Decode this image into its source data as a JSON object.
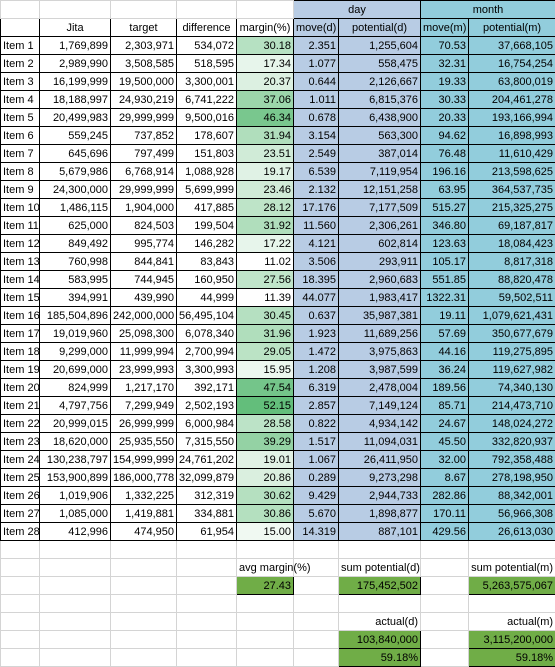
{
  "colors": {
    "day_header": "#b8cce4",
    "month_header": "#92cddc",
    "day_cells": "#b8cce4",
    "month_cells": "#92cddc",
    "summary_green": "#70ad47",
    "margin_scale_low": "#ffffff",
    "margin_scale_high": "#63be7b"
  },
  "groups": {
    "day": "day",
    "month": "month"
  },
  "headers": [
    "",
    "Jita",
    "target",
    "difference",
    "margin(%)",
    "move(d)",
    "potential(d)",
    "move(m)",
    "potential(m)"
  ],
  "rows": [
    [
      "Item 1",
      "1,769,899",
      "2,303,971",
      "534,072",
      "30.18",
      "2.351",
      "1,255,604",
      "70.53",
      "37,668,105"
    ],
    [
      "Item 2",
      "2,989,990",
      "3,508,585",
      "518,595",
      "17.34",
      "1.077",
      "558,475",
      "32.31",
      "16,754,254"
    ],
    [
      "Item 3",
      "16,199,999",
      "19,500,000",
      "3,300,001",
      "20.37",
      "0.644",
      "2,126,667",
      "19.33",
      "63,800,019"
    ],
    [
      "Item 4",
      "18,188,997",
      "24,930,219",
      "6,741,222",
      "37.06",
      "1.011",
      "6,815,376",
      "30.33",
      "204,461,278"
    ],
    [
      "Item 5",
      "20,499,983",
      "29,999,999",
      "9,500,016",
      "46.34",
      "0.678",
      "6,438,900",
      "20.33",
      "193,166,994"
    ],
    [
      "Item 6",
      "559,245",
      "737,852",
      "178,607",
      "31.94",
      "3.154",
      "563,300",
      "94.62",
      "16,898,993"
    ],
    [
      "Item 7",
      "645,696",
      "797,499",
      "151,803",
      "23.51",
      "2.549",
      "387,014",
      "76.48",
      "11,610,429"
    ],
    [
      "Item 8",
      "5,679,986",
      "6,768,914",
      "1,088,928",
      "19.17",
      "6.539",
      "7,119,954",
      "196.16",
      "213,598,625"
    ],
    [
      "Item 9",
      "24,300,000",
      "29,999,999",
      "5,699,999",
      "23.46",
      "2.132",
      "12,151,258",
      "63.95",
      "364,537,735"
    ],
    [
      "Item 10",
      "1,486,115",
      "1,904,000",
      "417,885",
      "28.12",
      "17.176",
      "7,177,509",
      "515.27",
      "215,325,275"
    ],
    [
      "Item 11",
      "625,000",
      "824,503",
      "199,504",
      "31.92",
      "11.560",
      "2,306,261",
      "346.80",
      "69,187,817"
    ],
    [
      "Item 12",
      "849,492",
      "995,774",
      "146,282",
      "17.22",
      "4.121",
      "602,814",
      "123.63",
      "18,084,423"
    ],
    [
      "Item 13",
      "760,998",
      "844,841",
      "83,843",
      "11.02",
      "3.506",
      "293,911",
      "105.17",
      "8,817,318"
    ],
    [
      "Item 14",
      "583,995",
      "744,945",
      "160,950",
      "27.56",
      "18.395",
      "2,960,683",
      "551.85",
      "88,820,478"
    ],
    [
      "Item 15",
      "394,991",
      "439,990",
      "44,999",
      "11.39",
      "44.077",
      "1,983,417",
      "1322.31",
      "59,502,511"
    ],
    [
      "Item 16",
      "185,504,896",
      "242,000,000",
      "56,495,104",
      "30.45",
      "0.637",
      "35,987,381",
      "19.11",
      "1,079,621,431"
    ],
    [
      "Item 17",
      "19,019,960",
      "25,098,300",
      "6,078,340",
      "31.96",
      "1.923",
      "11,689,256",
      "57.69",
      "350,677,679"
    ],
    [
      "Item 18",
      "9,299,000",
      "11,999,994",
      "2,700,994",
      "29.05",
      "1.472",
      "3,975,863",
      "44.16",
      "119,275,895"
    ],
    [
      "Item 19",
      "20,699,000",
      "23,999,993",
      "3,300,993",
      "15.95",
      "1.208",
      "3,987,599",
      "36.24",
      "119,627,982"
    ],
    [
      "Item 20",
      "824,999",
      "1,217,170",
      "392,171",
      "47.54",
      "6.319",
      "2,478,004",
      "189.56",
      "74,340,130"
    ],
    [
      "Item 21",
      "4,797,756",
      "7,299,949",
      "2,502,193",
      "52.15",
      "2.857",
      "7,149,124",
      "85.71",
      "214,473,710"
    ],
    [
      "Item 22",
      "20,999,015",
      "26,999,999",
      "6,000,984",
      "28.58",
      "0.822",
      "4,934,142",
      "24.67",
      "148,024,272"
    ],
    [
      "Item 23",
      "18,620,000",
      "25,935,550",
      "7,315,550",
      "39.29",
      "1.517",
      "11,094,031",
      "45.50",
      "332,820,937"
    ],
    [
      "Item 24",
      "130,238,797",
      "154,999,999",
      "24,761,202",
      "19.01",
      "1.067",
      "26,411,950",
      "32.00",
      "792,358,488"
    ],
    [
      "Item 25",
      "153,900,899",
      "186,000,778",
      "32,099,879",
      "20.86",
      "0.289",
      "9,273,298",
      "8.67",
      "278,198,950"
    ],
    [
      "Item 26",
      "1,019,906",
      "1,332,225",
      "312,319",
      "30.62",
      "9.429",
      "2,944,733",
      "282.86",
      "88,342,001"
    ],
    [
      "Item 27",
      "1,085,000",
      "1,419,881",
      "334,881",
      "30.86",
      "5.670",
      "1,898,877",
      "170.11",
      "56,966,308"
    ],
    [
      "Item 28",
      "412,996",
      "474,950",
      "61,954",
      "15.00",
      "14.319",
      "887,101",
      "429.56",
      "26,613,030"
    ]
  ],
  "margin_values": [
    30.18,
    17.34,
    20.37,
    37.06,
    46.34,
    31.94,
    23.51,
    19.17,
    23.46,
    28.12,
    31.92,
    17.22,
    11.02,
    27.56,
    11.39,
    30.45,
    31.96,
    29.05,
    15.95,
    47.54,
    52.15,
    28.58,
    39.29,
    19.01,
    20.86,
    30.62,
    30.86,
    15.0
  ],
  "summary": {
    "avg_margin_label": "avg margin(%)",
    "avg_margin_value": "27.43",
    "sum_potential_d_label": "sum potential(d)",
    "sum_potential_d_value": "175,452,502",
    "sum_potential_m_label": "sum potential(m)",
    "sum_potential_m_value": "5,263,575,067",
    "actual_d_label": "actual(d)",
    "actual_d_value": "103,840,000",
    "actual_d_pct": "59.18%",
    "actual_m_label": "actual(m)",
    "actual_m_value": "3,115,200,000",
    "actual_m_pct": "59.18%"
  }
}
